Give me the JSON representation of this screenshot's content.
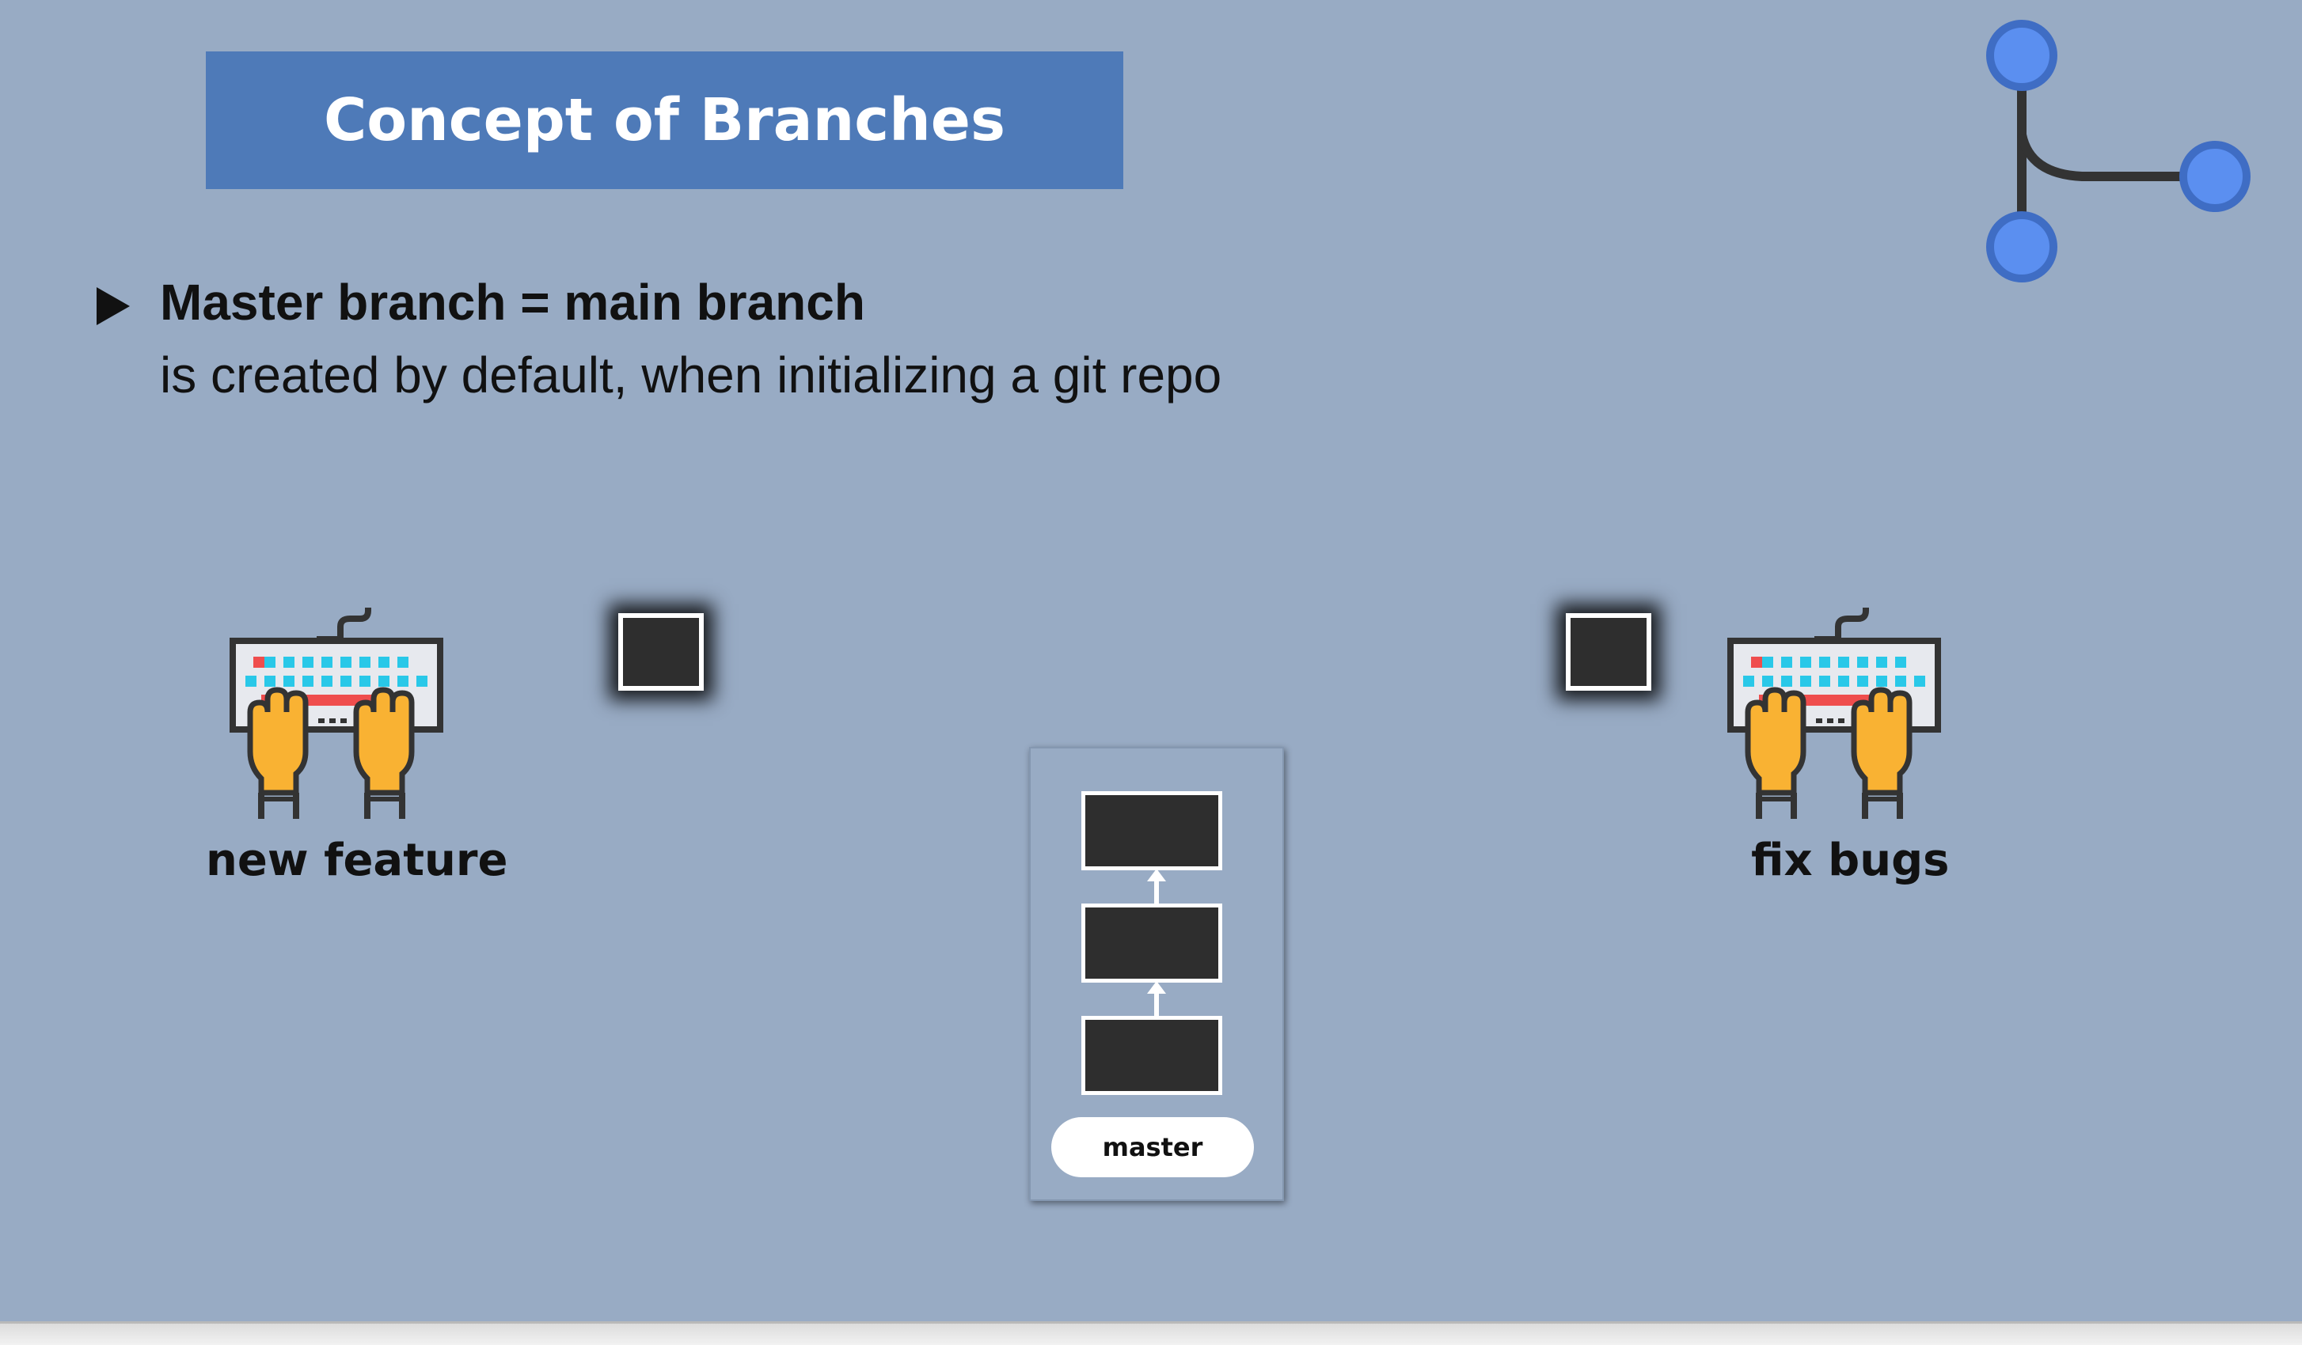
{
  "slide": {
    "title": "Concept of Branches",
    "bullet": {
      "main": "Master branch = main branch",
      "sub": "is created by default, when initializing a git repo"
    }
  },
  "figures": {
    "left_label": "new feature",
    "right_label": "fix bugs"
  },
  "master_branch": {
    "label": "master",
    "commits": 3
  },
  "colors": {
    "background": "#98abc4",
    "title_box": "#4e7ab8",
    "node_fill": "#5b8ff0",
    "commit_fill": "#2e2e2e",
    "keyboard_keys": "#29c8e8",
    "keyboard_accent": "#ef4d4d",
    "hands": "#f9b233"
  },
  "icons": {
    "branch_logo": "git-branch-icon",
    "figure_icon": "keyboard-hands-icon"
  }
}
